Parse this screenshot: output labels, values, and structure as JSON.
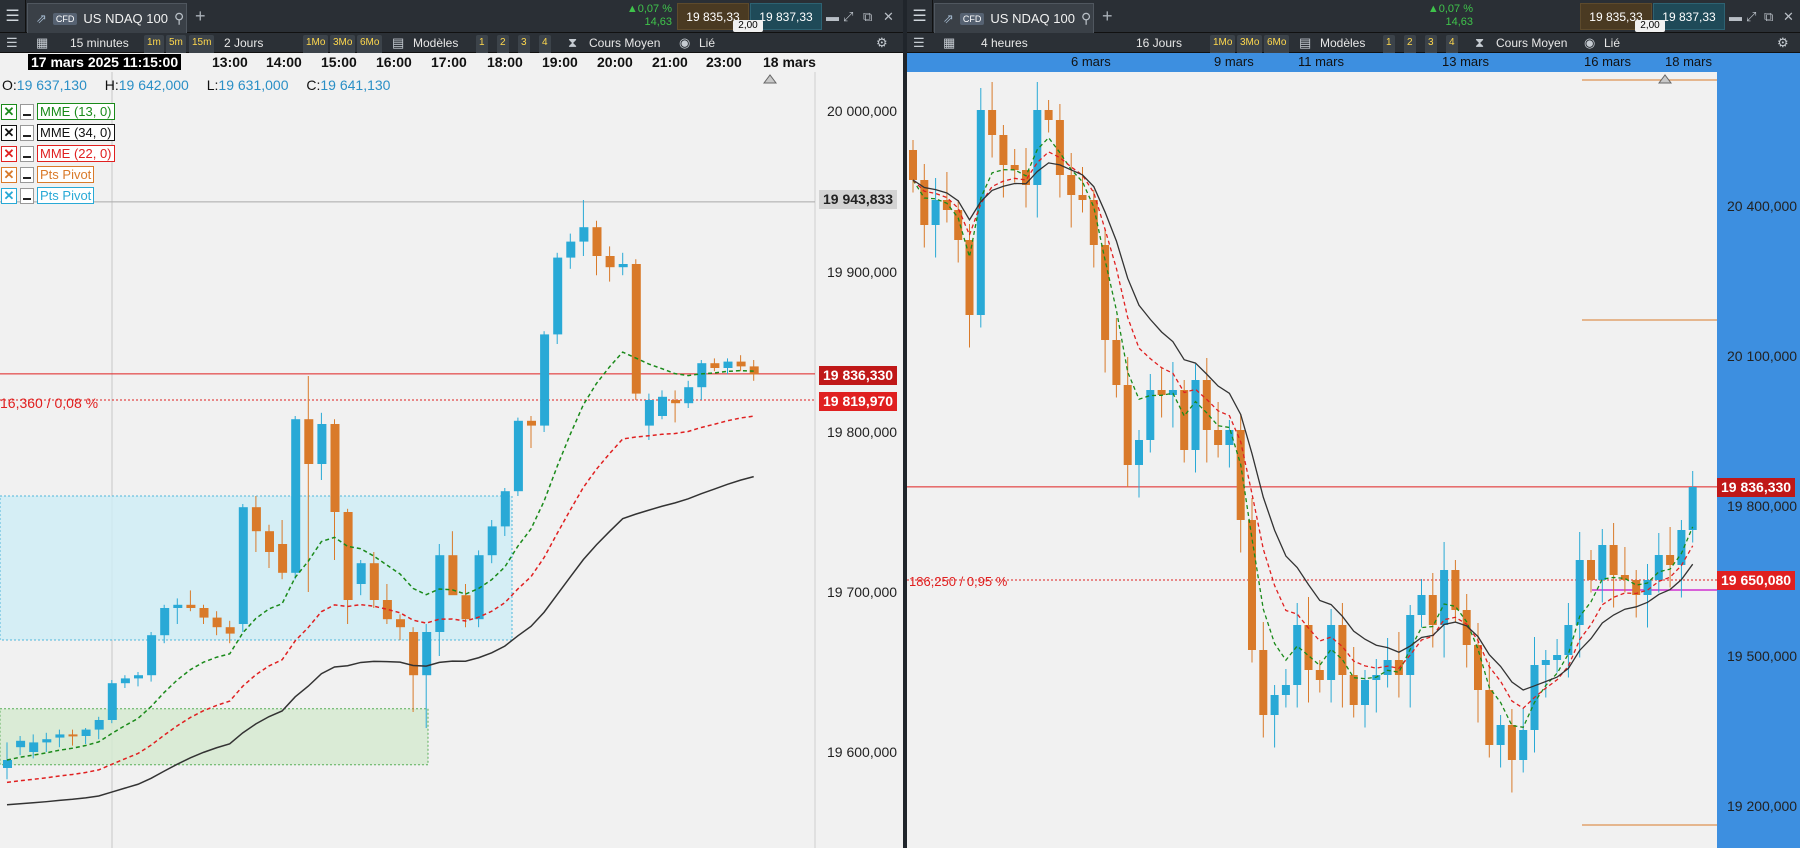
{
  "left": {
    "title": "US NDAQ 100",
    "instrument_badge": "CFD",
    "change_pct": "▲0,07 %",
    "change_abs": "14,63",
    "bid": "19 835,33",
    "ask": "19 837,33",
    "spread": "2,00",
    "toolbar": {
      "interval": "15 minutes",
      "tf1": "1m",
      "tf2": "5m",
      "tf3": "15m",
      "range": "2 Jours",
      "p1": "1Mo",
      "p2": "3Mo",
      "p3": "6Mo",
      "models": "Modèles",
      "n1": "1",
      "n2": "2",
      "n3": "3",
      "n4": "4",
      "price_mode": "Cours Moyen",
      "linked": "Lié"
    },
    "time_axis": {
      "current": "17 mars 2025 11:15:00",
      "labels": [
        "13:00",
        "14:00",
        "15:00",
        "16:00",
        "17:00",
        "18:00",
        "19:00",
        "20:00",
        "21:00",
        "23:00",
        "18 mars"
      ]
    },
    "ohlc": {
      "o_label": "O:",
      "o": "19 637,130",
      "h_label": "H:",
      "h": "19 642,000",
      "l_label": "L:",
      "l": "19 631,000",
      "c_label": "C:",
      "c": "19 641,130"
    },
    "legend": [
      {
        "text": "MME (13, 0)",
        "color": "#1a8a1a"
      },
      {
        "text": "MME (34, 0)",
        "color": "#111111"
      },
      {
        "text": "MME (22, 0)",
        "color": "#e02020"
      },
      {
        "text": "Pts Pivot",
        "color": "#d97a2a"
      },
      {
        "text": "Pts Pivot",
        "color": "#29a9d6"
      }
    ],
    "price_axis": [
      "20 000,000",
      "19 900,000",
      "19 800,000",
      "19 700,000",
      "19 600,000"
    ],
    "tag_gray": "19 943,833",
    "tag_current": "19 836,330",
    "tag_red": "19 819,970",
    "change_note": "16,360 / 0,08 %",
    "candles": [
      [
        19590,
        19606,
        19583,
        19595
      ],
      [
        19603,
        19610,
        19598,
        19607
      ],
      [
        19600,
        19611,
        19596,
        19606
      ],
      [
        19606,
        19612,
        19600,
        19608
      ],
      [
        19609,
        19614,
        19603,
        19611
      ],
      [
        19611,
        19614,
        19604,
        19610
      ],
      [
        19610,
        19615,
        19605,
        19614
      ],
      [
        19614,
        19622,
        19608,
        19620
      ],
      [
        19620,
        19645,
        19618,
        19643
      ],
      [
        19643,
        19648,
        19640,
        19646
      ],
      [
        19646,
        19650,
        19641,
        19648
      ],
      [
        19648,
        19675,
        19644,
        19673
      ],
      [
        19673,
        19692,
        19668,
        19690
      ],
      [
        19690,
        19696,
        19680,
        19692
      ],
      [
        19692,
        19701,
        19688,
        19690
      ],
      [
        19690,
        19692,
        19680,
        19684
      ],
      [
        19684,
        19688,
        19673,
        19678
      ],
      [
        19678,
        19682,
        19668,
        19674
      ],
      [
        19680,
        19755,
        19675,
        19753
      ],
      [
        19753,
        19760,
        19725,
        19738
      ],
      [
        19738,
        19742,
        19715,
        19725
      ],
      [
        19730,
        19745,
        19708,
        19712
      ],
      [
        19712,
        19810,
        19708,
        19808
      ],
      [
        19808,
        19835,
        19700,
        19780
      ],
      [
        19780,
        19812,
        19770,
        19805
      ],
      [
        19805,
        19808,
        19720,
        19750
      ],
      [
        19750,
        19752,
        19680,
        19695
      ],
      [
        19705,
        19720,
        19698,
        19718
      ],
      [
        19718,
        19725,
        19690,
        19695
      ],
      [
        19695,
        19705,
        19680,
        19683
      ],
      [
        19683,
        19686,
        19670,
        19678
      ],
      [
        19675,
        19678,
        19625,
        19648
      ],
      [
        19648,
        19680,
        19615,
        19675
      ],
      [
        19675,
        19730,
        19660,
        19723
      ],
      [
        19723,
        19738,
        19715,
        19698
      ],
      [
        19698,
        19705,
        19678,
        19683
      ],
      [
        19683,
        19726,
        19678,
        19723
      ],
      [
        19723,
        19745,
        19718,
        19741
      ],
      [
        19741,
        19765,
        19735,
        19763
      ],
      [
        19763,
        19809,
        19760,
        19807
      ],
      [
        19807,
        19810,
        19790,
        19804
      ],
      [
        19804,
        19863,
        19800,
        19861
      ],
      [
        19861,
        19912,
        19855,
        19909
      ],
      [
        19909,
        19924,
        19902,
        19919
      ],
      [
        19919,
        19945,
        19910,
        19928
      ],
      [
        19928,
        19932,
        19898,
        19910
      ],
      [
        19910,
        19916,
        19894,
        19903
      ],
      [
        19903,
        19912,
        19898,
        19905
      ],
      [
        19905,
        19908,
        19820,
        19824
      ],
      [
        19804,
        19824,
        19795,
        19820
      ],
      [
        19810,
        19826,
        19808,
        19822
      ],
      [
        19820,
        19826,
        19806,
        19818
      ],
      [
        19818,
        19832,
        19815,
        19828
      ],
      [
        19828,
        19845,
        19820,
        19843
      ],
      [
        19843,
        19846,
        19838,
        19840
      ],
      [
        19840,
        19846,
        19836,
        19844
      ],
      [
        19844,
        19848,
        19838,
        19841
      ],
      [
        19841,
        19845,
        19832,
        19836
      ]
    ]
  },
  "right": {
    "title": "US NDAQ 100",
    "instrument_badge": "CFD",
    "change_pct": "▲0,07 %",
    "change_abs": "14,63",
    "bid": "19 835,33",
    "ask": "19 837,33",
    "spread": "2,00",
    "toolbar": {
      "interval": "4 heures",
      "range": "16 Jours",
      "p1": "1Mo",
      "p2": "3Mo",
      "p3": "6Mo",
      "models": "Modèles",
      "n1": "1",
      "n2": "2",
      "n3": "3",
      "n4": "4",
      "price_mode": "Cours Moyen",
      "linked": "Lié"
    },
    "time_axis": {
      "labels": [
        "6 mars",
        "9 mars",
        "11 mars",
        "13 mars",
        "16 mars",
        "18 mars"
      ]
    },
    "price_axis": [
      "20 400,000",
      "20 100,000",
      "19 800,000",
      "19 500,000",
      "19 200,000"
    ],
    "tag_current": "19 836,330",
    "tag_red": "19 650,080",
    "change_note": "186,250 / 0,95 %",
    "colors": {
      "up": "#29a9d6",
      "down": "#d97a2a",
      "ema13": "#1a8a1a",
      "ema22": "#e02020",
      "ema34": "#111111",
      "axis_bg": "#3d8fe0"
    }
  }
}
